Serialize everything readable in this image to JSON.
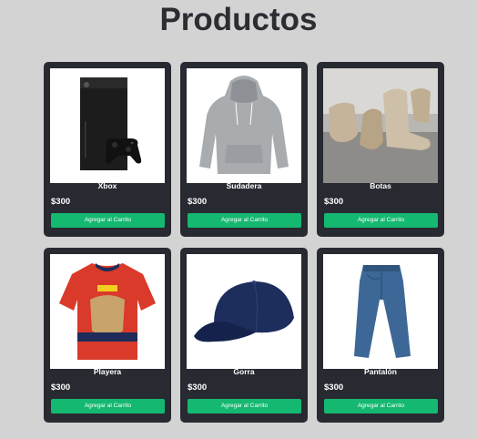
{
  "page": {
    "title": "Productos"
  },
  "products": [
    {
      "name": "Xbox",
      "price": "$300",
      "button_label": "Agregar al Carrito",
      "image_icon": "xbox-console-image"
    },
    {
      "name": "Sudadera",
      "price": "$300",
      "button_label": "Agregar al Carrito",
      "image_icon": "hoodie-image"
    },
    {
      "name": "Botas",
      "price": "$300",
      "button_label": "Agregar al Carrito",
      "image_icon": "boots-image"
    },
    {
      "name": "Playera",
      "price": "$300",
      "button_label": "Agregar al Carrito",
      "image_icon": "jersey-image"
    },
    {
      "name": "Gorra",
      "price": "$300",
      "button_label": "Agregar al Carrito",
      "image_icon": "cap-image"
    },
    {
      "name": "Pantalón",
      "price": "$300",
      "button_label": "Agregar al Carrito",
      "image_icon": "jeans-image"
    }
  ],
  "colors": {
    "background": "#d3d3d3",
    "card": "#282a31",
    "button": "#15b870",
    "title": "#2b2d33"
  }
}
